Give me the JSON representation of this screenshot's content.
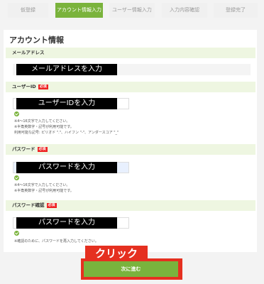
{
  "steps": [
    {
      "label": "仮登録",
      "active": false
    },
    {
      "label": "アカウント情報入力",
      "active": true
    },
    {
      "label": "ユーザー情報入力",
      "active": false
    },
    {
      "label": "入力内容確認",
      "active": false
    },
    {
      "label": "登録完了",
      "active": false
    }
  ],
  "form": {
    "title": "アカウント情報",
    "email": {
      "label": "メールアドレス",
      "placeholder_overlay": "メールアドレスを入力"
    },
    "user_id": {
      "label": "ユーザーID",
      "required_badge": "必須",
      "placeholder_overlay": "ユーザーIDを入力",
      "notes": [
        "※4～16文字で入力してください。",
        "※半角英数字・記号が利用可能です。",
        "利用可能な記号: ピリオド \".\"、ハイフン \"-\"、アンダースコア \"_\""
      ]
    },
    "password": {
      "label": "パスワード",
      "required_badge": "必須",
      "placeholder_overlay": "パスワードを入力",
      "notes": [
        "※4～16文字で入力してください。",
        "※半角英数字・記号が利用可能です。"
      ]
    },
    "password_confirm": {
      "label": "パスワード確認",
      "required_badge": "必須",
      "placeholder_overlay": "パスワードを入力",
      "notes": [
        "※確認のために、パスワードを再入力してください。"
      ]
    }
  },
  "annotation": {
    "click_label": "クリック"
  },
  "next_button": {
    "label": "次に進む"
  },
  "colors": {
    "accent_green": "#7ab33c",
    "annotation_red": "#e53020",
    "required_red": "#e22"
  }
}
